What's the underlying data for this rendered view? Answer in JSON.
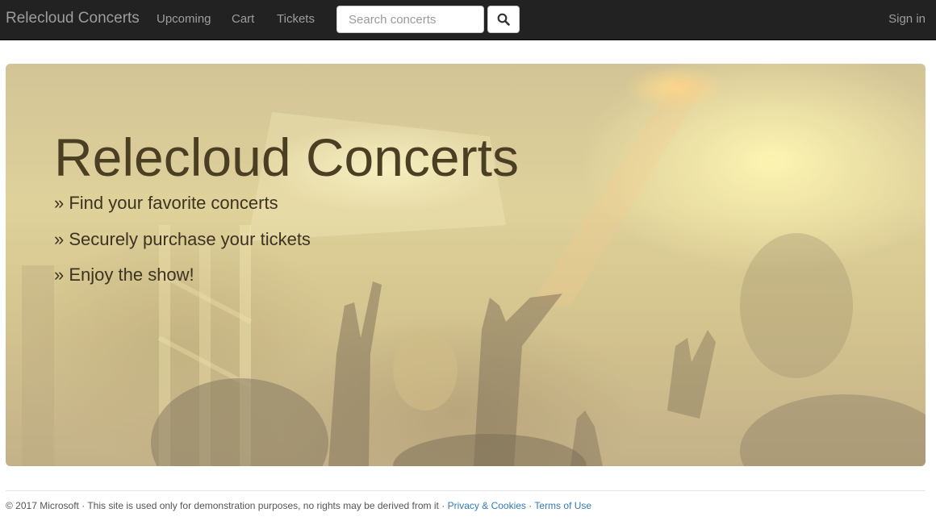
{
  "navbar": {
    "brand": "Relecloud Concerts",
    "links": [
      {
        "label": "Upcoming"
      },
      {
        "label": "Cart"
      },
      {
        "label": "Tickets"
      }
    ],
    "search": {
      "placeholder": "Search concerts",
      "value": ""
    },
    "search_button_icon": "search-icon",
    "signin_label": "Sign in"
  },
  "hero": {
    "title": "Relecloud Concerts",
    "lines": [
      "» Find your favorite concerts",
      "» Securely purchase your tickets",
      "» Enjoy the show!"
    ]
  },
  "footer": {
    "copyright": "© 2017 Microsoft",
    "sep1": " · ",
    "disclaimer": "This site is used only for demonstration purposes, no rights may be derived from it",
    "sep2": " · ",
    "privacy_label": "Privacy & Cookies",
    "sep3": " · ",
    "terms_label": "Terms of Use"
  },
  "colors": {
    "navbar_bg": "#222222",
    "nav_text": "#9d9d9d",
    "link": "#337ab7",
    "footer_text": "#555555"
  }
}
